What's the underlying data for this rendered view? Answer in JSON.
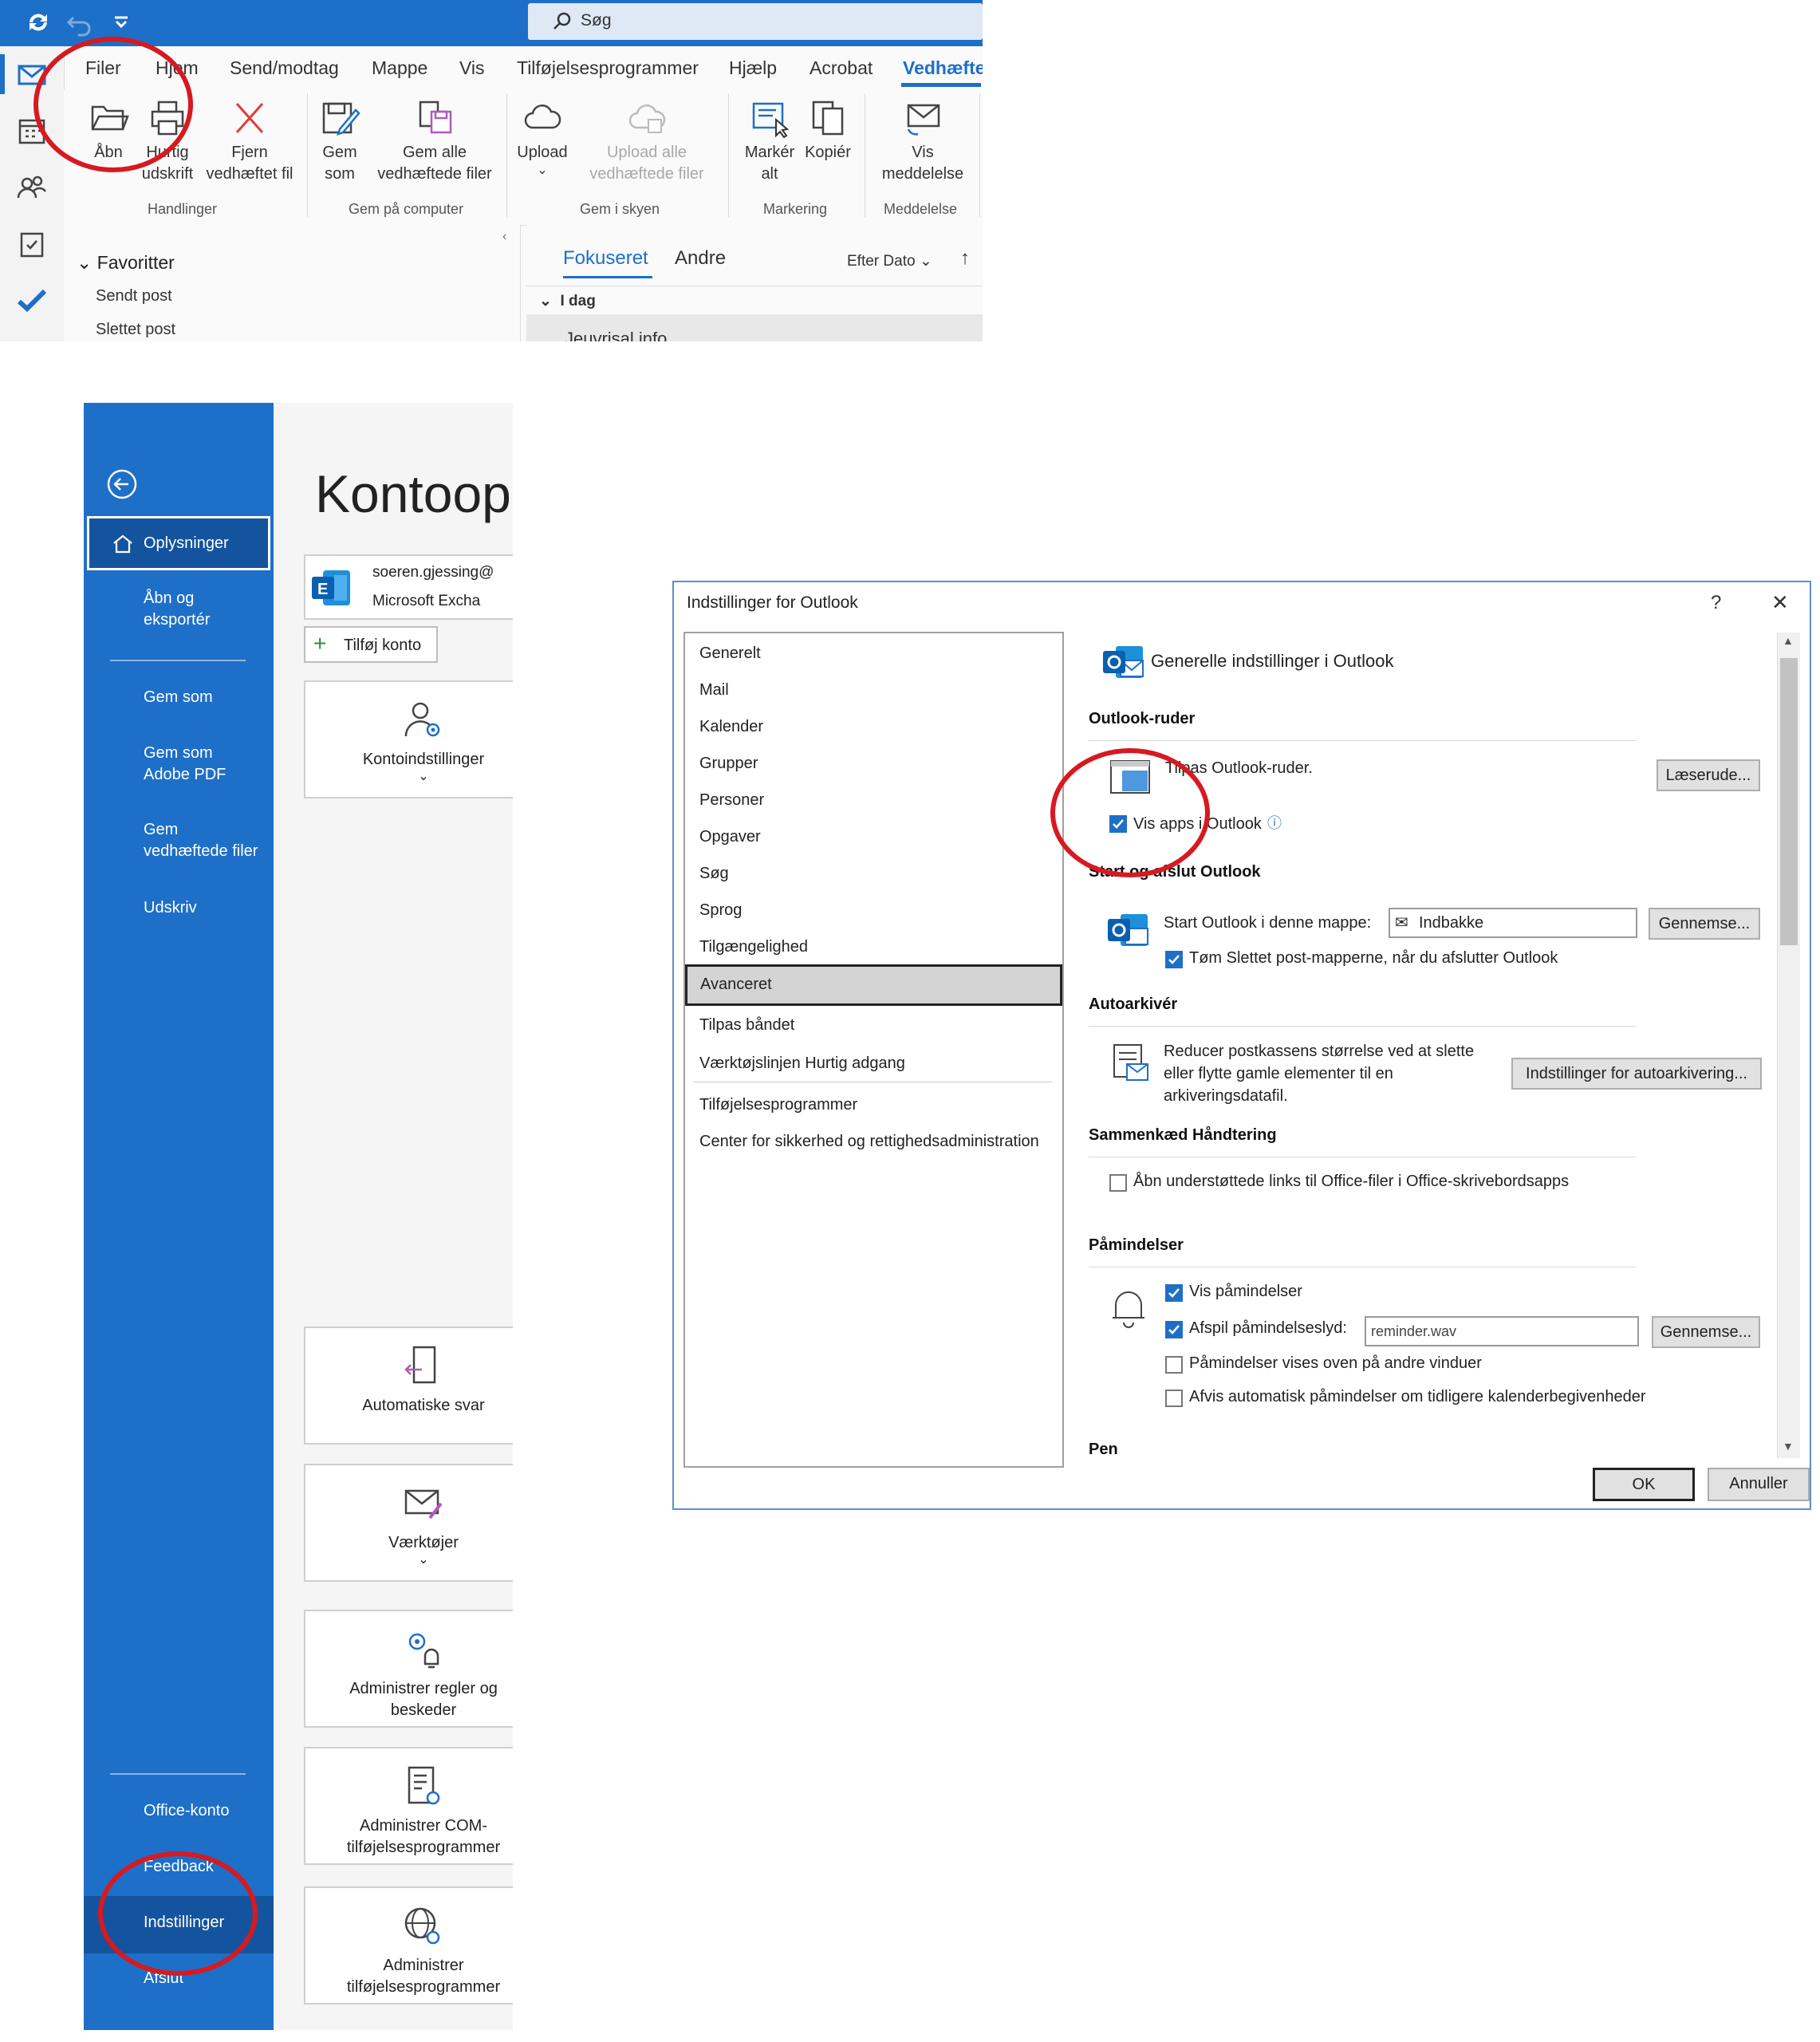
{
  "ribbon": {
    "search_label": "Søg",
    "tabs": [
      "Filer",
      "Hjem",
      "Send/modtag",
      "Mappe",
      "Vis",
      "Tilføjelsesprogrammer",
      "Hjælp",
      "Acrobat",
      "Vedhæfte"
    ],
    "buttons": {
      "open": "Åbn",
      "quick_print_1": "Hurtig",
      "quick_print_2": "udskrift",
      "remove_1": "Fjern",
      "remove_2": "vedhæftet fil",
      "save_as_1": "Gem",
      "save_as_2": "som",
      "save_all_1": "Gem alle",
      "save_all_2": "vedhæftede filer",
      "upload": "Upload",
      "upload_all_1": "Upload alle",
      "upload_all_2": "vedhæftede filer",
      "select_all_1": "Markér",
      "select_all_2": "alt",
      "copy": "Kopiér",
      "show_1": "Vis",
      "show_2": "meddelelse"
    },
    "groups": [
      "Handlinger",
      "Gem på computer",
      "Gem i skyen",
      "Markering",
      "Meddelelse"
    ]
  },
  "folders": {
    "favorites": "Favoritter",
    "items": [
      "Sendt post",
      "Slettet post"
    ]
  },
  "messages": {
    "tabs": [
      "Fokuseret",
      "Andre"
    ],
    "sort": "Efter Dato",
    "group_today": "I dag",
    "first_sender": "Jeuvrisal info"
  },
  "backstage": {
    "title": "Kontoop",
    "nav": {
      "info": "Oplysninger",
      "open_export_1": "Åbn og",
      "open_export_2": "eksportér",
      "save_as": "Gem som",
      "save_pdf_1": "Gem som",
      "save_pdf_2": "Adobe PDF",
      "save_att_1": "Gem",
      "save_att_2": "vedhæftede filer",
      "print": "Udskriv",
      "office_account": "Office-konto",
      "feedback": "Feedback",
      "settings": "Indstillinger",
      "exit": "Afslut"
    },
    "account_email": "soeren.gjessing@",
    "account_type": "Microsoft Excha",
    "add_account": "Tilføj konto",
    "tiles": {
      "account_settings": "Kontoindstillinger",
      "auto_reply": "Automatiske svar",
      "tools": "Værktøjer",
      "rules_1": "Administrer regler og",
      "rules_2": "beskeder",
      "com_1": "Administrer COM-",
      "com_2": "tilføjelsesprogrammer",
      "addins_1": "Administrer",
      "addins_2": "tilføjelsesprogrammer"
    }
  },
  "dialog": {
    "title": "Indstillinger for Outlook",
    "help": "?",
    "close": "✕",
    "nav": [
      "Generelt",
      "Mail",
      "Kalender",
      "Grupper",
      "Personer",
      "Opgaver",
      "Søg",
      "Sprog",
      "Tilgængelighed",
      "Avanceret",
      "Tilpas båndet",
      "Værktøjslinjen Hurtig adgang",
      "Tilføjelsesprogrammer",
      "Center for sikkerhed og rettighedsadministration"
    ],
    "header": "Generelle indstillinger i Outlook",
    "sections": {
      "panes": "Outlook-ruder",
      "startup": "Start og afslut Outlook",
      "autoarchive": "Autoarkivér",
      "linked": "Sammenkæd Håndtering",
      "reminders": "Påmindelser",
      "pen": "Pen"
    },
    "options": {
      "customize_panes": "Tilpas Outlook-ruder.",
      "reading_pane_btn": "Læserude...",
      "show_apps": "Vis apps i Outlook",
      "start_folder_label": "Start Outlook i denne mappe:",
      "start_folder_value": "Indbakke",
      "browse": "Gennemse...",
      "empty_deleted": "Tøm Slettet post-mapperne, når du afslutter Outlook",
      "autoarchive_1": "Reducer postkassens størrelse ved at slette",
      "autoarchive_2": "eller flytte gamle elementer til en",
      "autoarchive_3": "arkiveringsdatafil.",
      "autoarchive_btn": "Indstillinger for autoarkivering...",
      "open_links": "Åbn understøttede links til Office-filer i Office-skrivebordsapps",
      "show_reminders": "Vis påmindelser",
      "play_sound": "Afspil påmindelseslyd:",
      "sound_file": "reminder.wav",
      "on_top": "Påmindelser vises oven på andre vinduer",
      "dismiss": "Afvis automatisk påmindelser om tidligere kalenderbegivenheder"
    },
    "ok": "OK",
    "cancel": "Annuller"
  },
  "colors": {
    "accent": "#1e6fc8",
    "annotation": "#d71920"
  }
}
